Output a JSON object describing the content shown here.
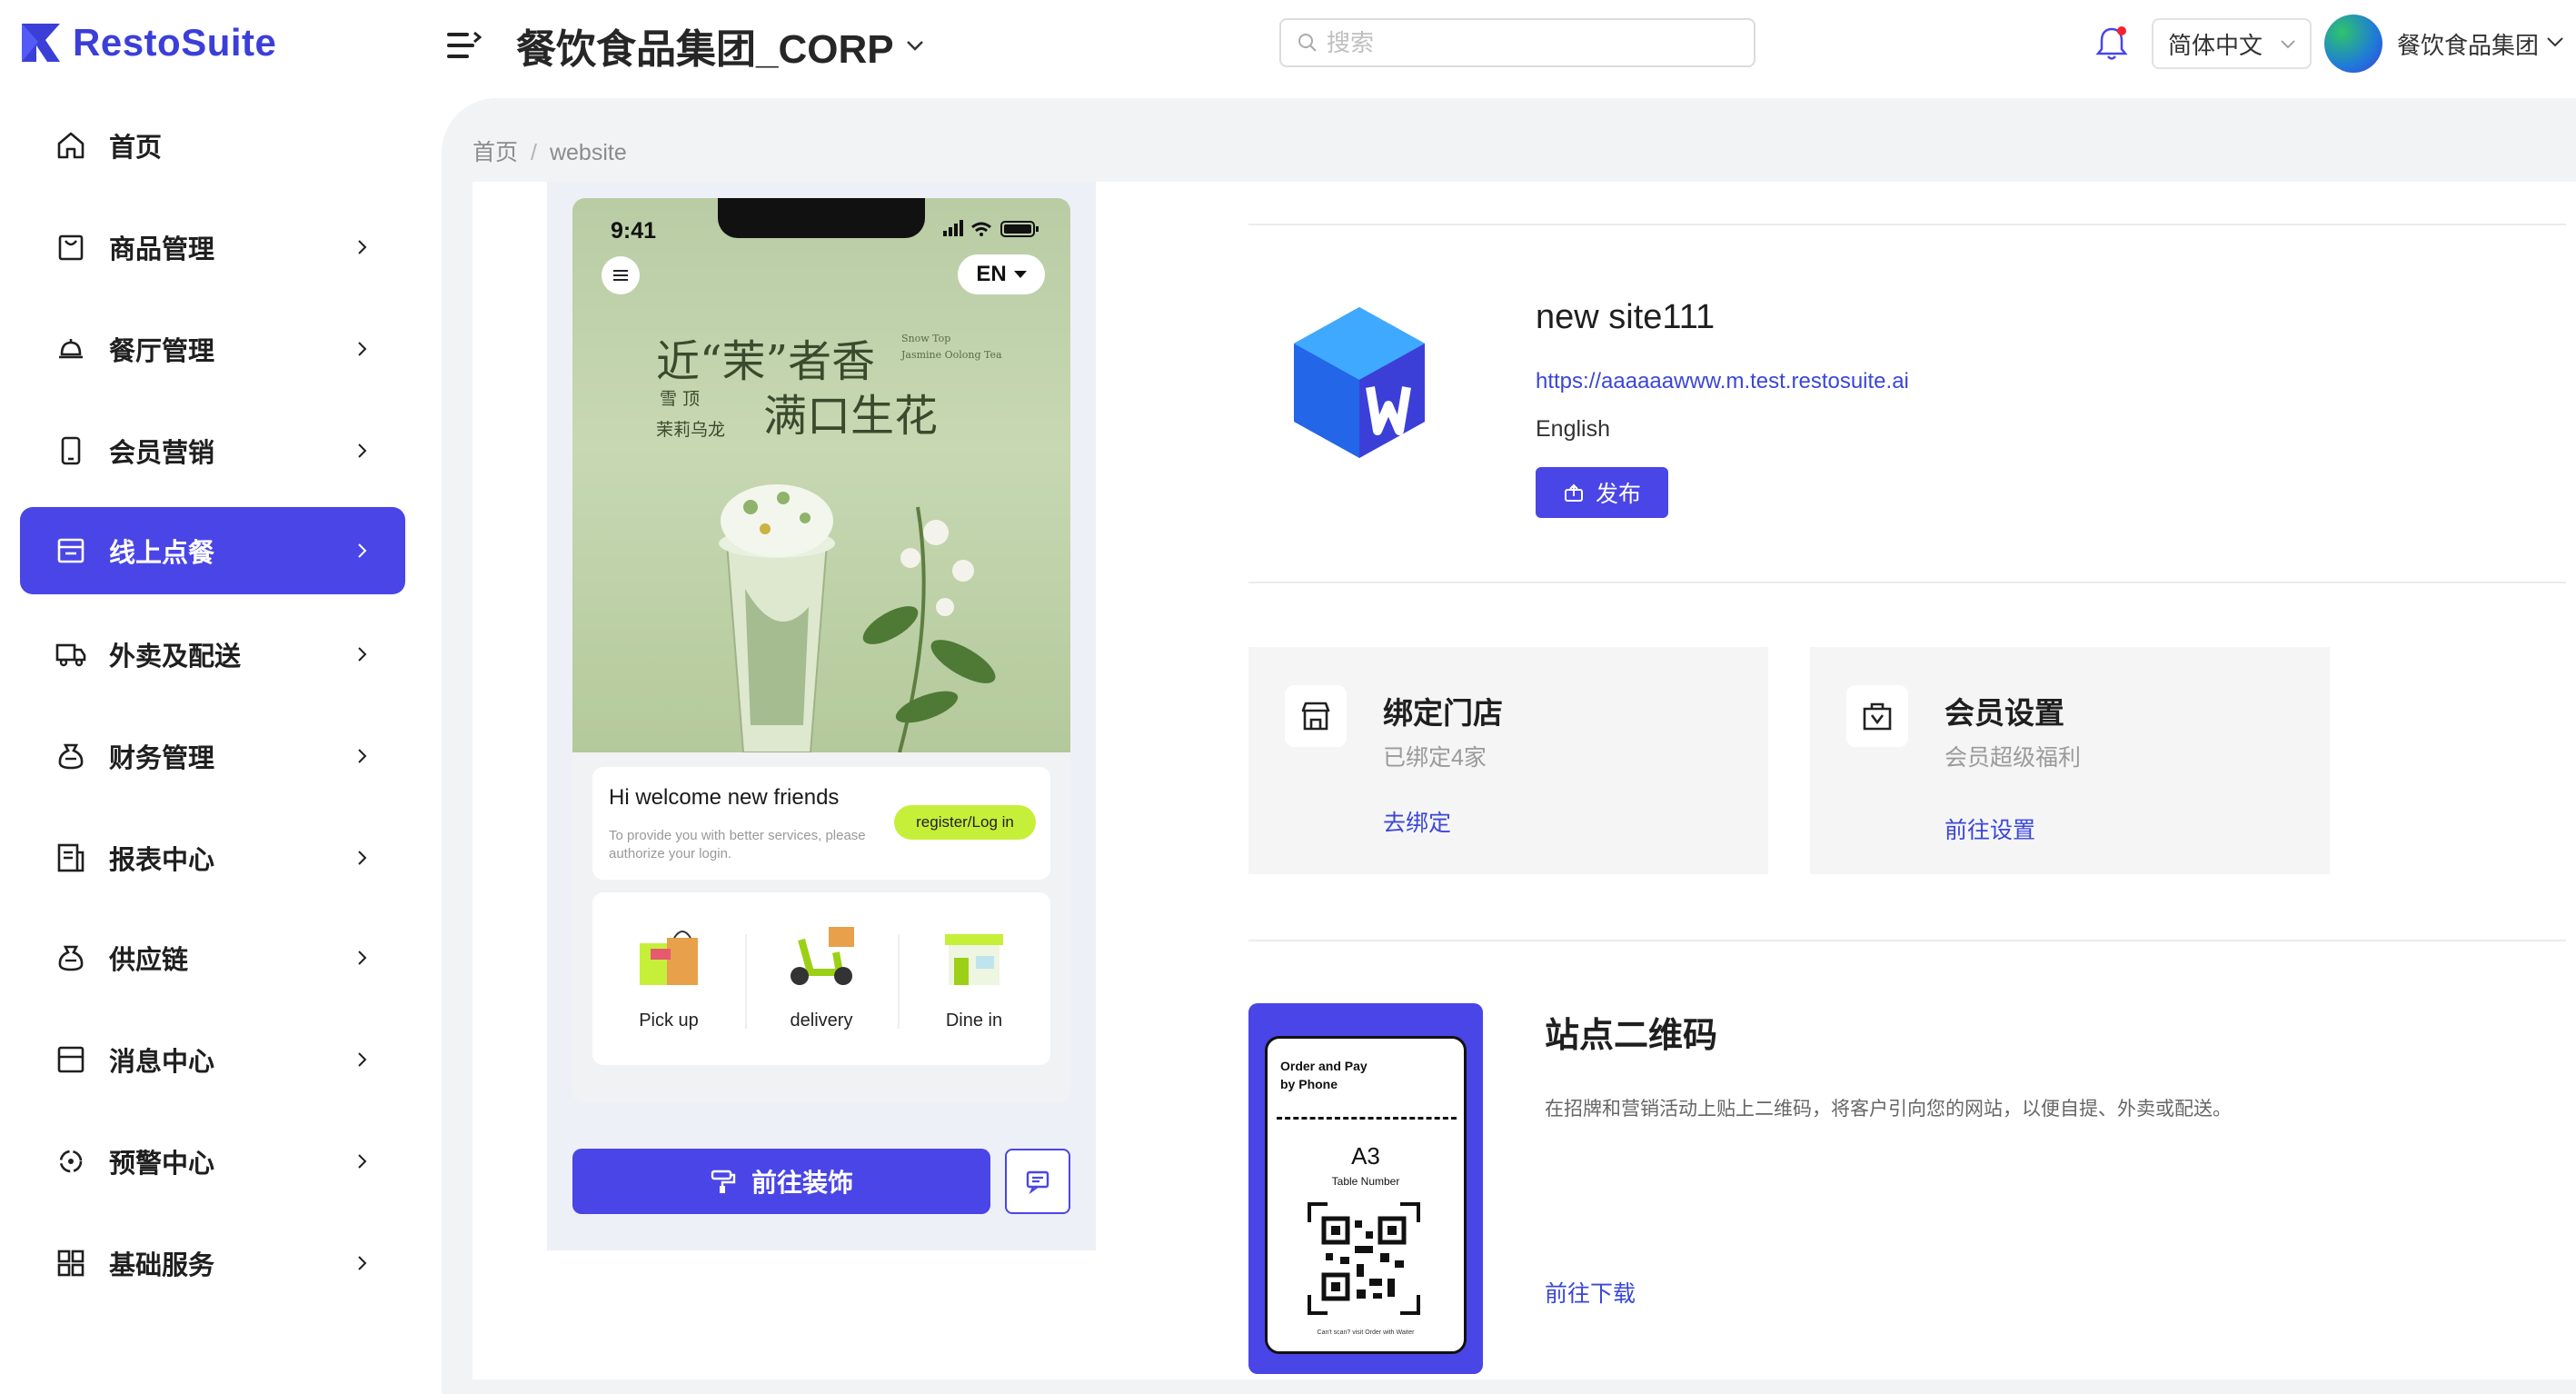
{
  "header": {
    "brand": "RestoSuite",
    "corp_title": "餐饮食品集团_CORP",
    "search_placeholder": "搜索",
    "language": "简体中文",
    "user_name": "餐饮食品集团"
  },
  "colors": {
    "accent": "#4a45e6",
    "link": "#3b46d8",
    "content_bg": "#f2f3f5"
  },
  "sidebar": {
    "items": [
      {
        "label": "首页",
        "icon": "home-icon",
        "active": false,
        "has_arrow": false
      },
      {
        "label": "商品管理",
        "icon": "shopping-bag-icon",
        "active": false,
        "has_arrow": true
      },
      {
        "label": "餐厅管理",
        "icon": "cloche-icon",
        "active": false,
        "has_arrow": true
      },
      {
        "label": "会员营销",
        "icon": "phone-icon",
        "active": false,
        "has_arrow": true
      },
      {
        "label": "线上点餐",
        "icon": "online-order-icon",
        "active": true,
        "has_arrow": true
      },
      {
        "label": "外卖及配送",
        "icon": "truck-icon",
        "active": false,
        "has_arrow": true
      },
      {
        "label": "财务管理",
        "icon": "money-bag-icon",
        "active": false,
        "has_arrow": true
      },
      {
        "label": "报表中心",
        "icon": "report-icon",
        "active": false,
        "has_arrow": true
      },
      {
        "label": "供应链",
        "icon": "supply-icon",
        "active": false,
        "has_arrow": true
      },
      {
        "label": "消息中心",
        "icon": "message-box-icon",
        "active": false,
        "has_arrow": true
      },
      {
        "label": "预警中心",
        "icon": "alert-icon",
        "active": false,
        "has_arrow": true
      },
      {
        "label": "基础服务",
        "icon": "grid-icon",
        "active": false,
        "has_arrow": true
      }
    ]
  },
  "breadcrumb": {
    "home": "首页",
    "separator": "/",
    "current": "website"
  },
  "phone_preview": {
    "time": "9:41",
    "language_pill": "EN",
    "hero_line1": "近“茉”者香",
    "hero_line2": "满口生花",
    "hero_small_en1": "Snow Top",
    "hero_small_en2": "Jasmine Oolong Tea",
    "hero_small_cn1": "雪  顶",
    "hero_small_cn2": "茉莉乌龙",
    "welcome_title": "Hi welcome new friends",
    "welcome_subtitle": "To provide you with better services, please authorize your login.",
    "login_button": "register/Log in",
    "services": [
      {
        "label": "Pick up",
        "icon": "pickup-bag-icon"
      },
      {
        "label": "delivery",
        "icon": "scooter-icon"
      },
      {
        "label": "Dine in",
        "icon": "restaurant-icon"
      }
    ]
  },
  "actions": {
    "decorate_button": "前往装饰"
  },
  "site": {
    "name": "new site111",
    "url": "https://aaaaaawww.m.test.restosuite.ai",
    "language": "English",
    "publish_button": "发布"
  },
  "features": [
    {
      "title": "绑定门店",
      "subtitle": "已绑定4家",
      "link": "去绑定",
      "icon": "store-icon"
    },
    {
      "title": "会员设置",
      "subtitle": "会员超级福利",
      "link": "前往设置",
      "icon": "member-icon"
    }
  ],
  "qr_section": {
    "title": "站点二维码",
    "description": "在招牌和营销活动上贴上二维码，将客户引向您的网站，以便自提、外卖或配送。",
    "download_link": "前往下载",
    "card_heading_line1": "Order and Pay",
    "card_heading_line2": "by Phone",
    "table_code": "A3",
    "table_label": "Table  Number",
    "card_footer": "Can't scan? visit Order with Waiter"
  }
}
